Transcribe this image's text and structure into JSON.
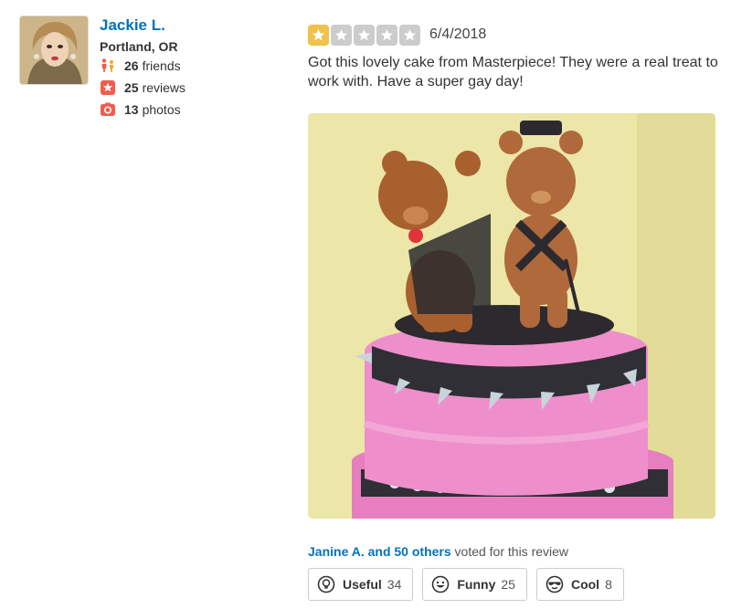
{
  "user": {
    "name": "Jackie L.",
    "location": "Portland, OR",
    "stats": {
      "friends": {
        "count": "26",
        "label": "friends",
        "icon": "friends-icon"
      },
      "reviews": {
        "count": "25",
        "label": "reviews",
        "icon": "star-badge-icon"
      },
      "photos": {
        "count": "13",
        "label": "photos",
        "icon": "camera-icon"
      }
    }
  },
  "review": {
    "rating": 1,
    "max_rating": 5,
    "date": "6/4/2018",
    "text": "Got this lovely cake from Masterpiece!  They were a real treat to work with.  Have a super gay day!"
  },
  "votes": {
    "voters_link": "Janine A. and 50 others",
    "suffix": " voted for this review"
  },
  "actions": [
    {
      "label": "Useful",
      "count": "34",
      "icon": "lightbulb-icon"
    },
    {
      "label": "Funny",
      "count": "25",
      "icon": "smiley-icon"
    },
    {
      "label": "Cool",
      "count": "8",
      "icon": "sunglasses-icon"
    }
  ],
  "colors": {
    "link": "#0073bb",
    "star_on": "#f0c14b",
    "star_off": "#cccccc",
    "stat_icon": "#f15c4f"
  }
}
